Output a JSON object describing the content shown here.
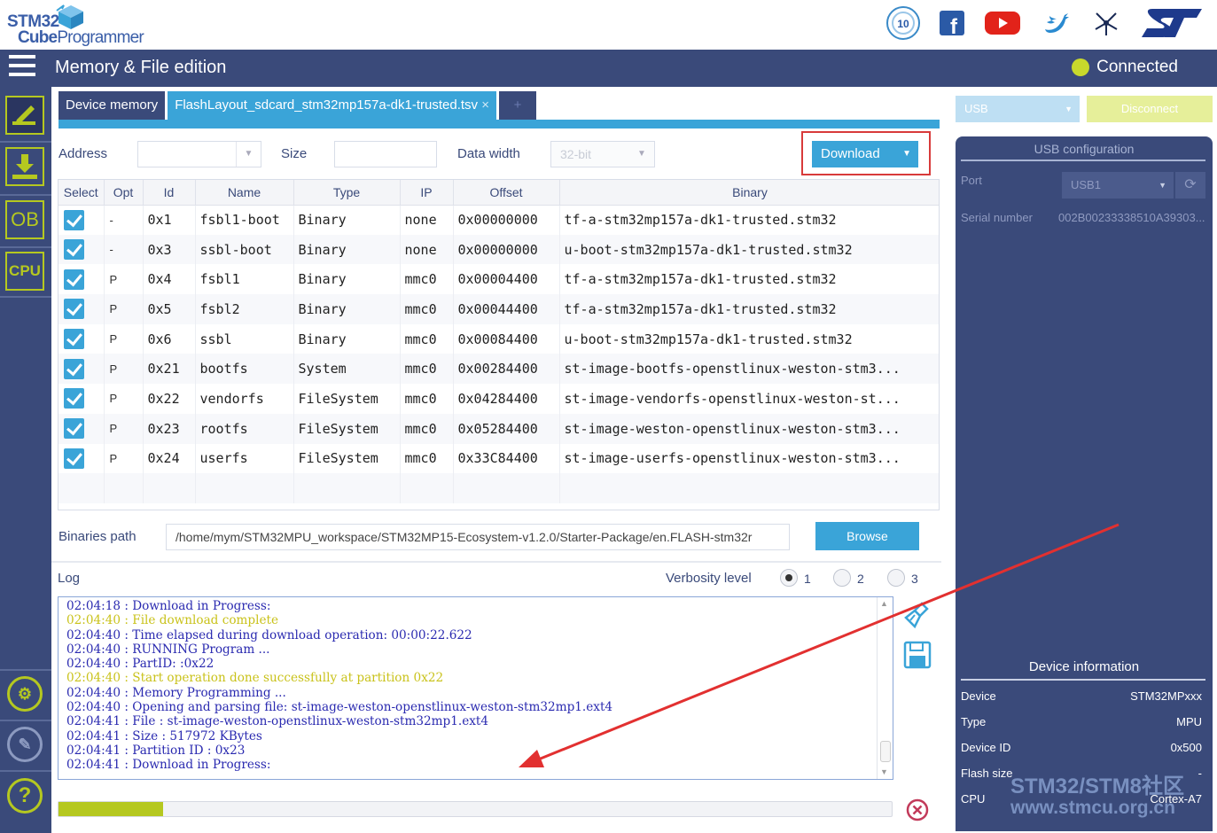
{
  "brand": {
    "line1": "STM32",
    "line2a": "Cube",
    "line2b": "Programmer"
  },
  "social_icons": [
    "anniversary-badge-icon",
    "facebook-icon",
    "youtube-icon",
    "twitter-icon",
    "network-icon",
    "st-logo-icon"
  ],
  "header": {
    "title": "Memory & File edition",
    "status": "Connected",
    "status_color": "#c8d92c"
  },
  "sidebar": {
    "items": [
      "edit-icon",
      "download-icon",
      "OB",
      "CPU"
    ],
    "bottom": [
      "swv-icon",
      "plugin-icon",
      "help-icon"
    ]
  },
  "tabs": [
    {
      "label": "Device memory"
    },
    {
      "label": "FlashLayout_sdcard_stm32mp157a-dk1-trusted.tsv",
      "close": "×"
    },
    {
      "label": "+"
    }
  ],
  "controls": {
    "address_label": "Address",
    "address_value": "",
    "size_label": "Size",
    "size_value": "",
    "data_width_label": "Data width",
    "data_width_value": "32-bit",
    "download_label": "Download"
  },
  "table": {
    "headers": [
      "Select",
      "Opt",
      "Id",
      "Name",
      "Type",
      "IP",
      "Offset",
      "Binary"
    ],
    "rows": [
      {
        "checked": true,
        "opt": "-",
        "id": "0x1",
        "name": "fsbl1-boot",
        "type": "Binary",
        "ip": "none",
        "offset": "0x00000000",
        "binary": "tf-a-stm32mp157a-dk1-trusted.stm32"
      },
      {
        "checked": true,
        "opt": "-",
        "id": "0x3",
        "name": "ssbl-boot",
        "type": "Binary",
        "ip": "none",
        "offset": "0x00000000",
        "binary": "u-boot-stm32mp157a-dk1-trusted.stm32"
      },
      {
        "checked": true,
        "opt": "P",
        "id": "0x4",
        "name": "fsbl1",
        "type": "Binary",
        "ip": "mmc0",
        "offset": "0x00004400",
        "binary": "tf-a-stm32mp157a-dk1-trusted.stm32"
      },
      {
        "checked": true,
        "opt": "P",
        "id": "0x5",
        "name": "fsbl2",
        "type": "Binary",
        "ip": "mmc0",
        "offset": "0x00044400",
        "binary": "tf-a-stm32mp157a-dk1-trusted.stm32"
      },
      {
        "checked": true,
        "opt": "P",
        "id": "0x6",
        "name": "ssbl",
        "type": "Binary",
        "ip": "mmc0",
        "offset": "0x00084400",
        "binary": "u-boot-stm32mp157a-dk1-trusted.stm32"
      },
      {
        "checked": true,
        "opt": "P",
        "id": "0x21",
        "name": "bootfs",
        "type": "System",
        "ip": "mmc0",
        "offset": "0x00284400",
        "binary": "st-image-bootfs-openstlinux-weston-stm3..."
      },
      {
        "checked": true,
        "opt": "P",
        "id": "0x22",
        "name": "vendorfs",
        "type": "FileSystem",
        "ip": "mmc0",
        "offset": "0x04284400",
        "binary": "st-image-vendorfs-openstlinux-weston-st..."
      },
      {
        "checked": true,
        "opt": "P",
        "id": "0x23",
        "name": "rootfs",
        "type": "FileSystem",
        "ip": "mmc0",
        "offset": "0x05284400",
        "binary": "st-image-weston-openstlinux-weston-stm3..."
      },
      {
        "checked": true,
        "opt": "P",
        "id": "0x24",
        "name": "userfs",
        "type": "FileSystem",
        "ip": "mmc0",
        "offset": "0x33C84400",
        "binary": "st-image-userfs-openstlinux-weston-stm3..."
      }
    ]
  },
  "binaries": {
    "label": "Binaries path",
    "path": "/home/mym/STM32MPU_workspace/STM32MP15-Ecosystem-v1.2.0/Starter-Package/en.FLASH-stm32r",
    "browse_label": "Browse"
  },
  "log": {
    "label": "Log",
    "verbosity_label": "Verbosity level",
    "levels": [
      "1",
      "2",
      "3"
    ],
    "selected_level": "1",
    "lines": [
      {
        "text": "02:04:18 : Download in Progress:",
        "color": "blue"
      },
      {
        "text": "02:04:40 : File download complete",
        "color": "yellow"
      },
      {
        "text": "02:04:40 : Time elapsed during download operation: 00:00:22.622",
        "color": "blue"
      },
      {
        "text": "02:04:40 : RUNNING Program ...",
        "color": "blue"
      },
      {
        "text": "02:04:40 : PartID: :0x22",
        "color": "blue"
      },
      {
        "text": "02:04:40 : Start operation done successfully at partition 0x22",
        "color": "yellow"
      },
      {
        "text": "02:04:40 : Memory Programming ...",
        "color": "blue"
      },
      {
        "text": "02:04:40 : Opening and parsing file: st-image-weston-openstlinux-weston-stm32mp1.ext4",
        "color": "blue"
      },
      {
        "text": "02:04:41 : File : st-image-weston-openstlinux-weston-stm32mp1.ext4",
        "color": "blue"
      },
      {
        "text": "02:04:41 : Size : 517972 KBytes",
        "color": "blue"
      },
      {
        "text": "02:04:41 : Partition ID : 0x23",
        "color": "blue"
      },
      {
        "text": "02:04:41 : Download in Progress:",
        "color": "blue"
      }
    ],
    "progress_fraction": 0.125
  },
  "connection": {
    "interface": "USB",
    "disconnect_label": "Disconnect",
    "config_title": "USB configuration",
    "port_label": "Port",
    "port_value": "USB1",
    "serial_label": "Serial number",
    "serial_value": "002B00233338510A39303..."
  },
  "device_info": {
    "title": "Device information",
    "rows": [
      {
        "key": "Device",
        "value": "STM32MPxxx"
      },
      {
        "key": "Type",
        "value": "MPU"
      },
      {
        "key": "Device ID",
        "value": "0x500"
      },
      {
        "key": "Flash size",
        "value": "-"
      },
      {
        "key": "CPU",
        "value": "Cortex-A7"
      }
    ]
  },
  "watermark": {
    "line1": "STM32/STM8社区",
    "line2": "www.stmcu.org.cn"
  },
  "colors": {
    "navy": "#3a4a7a",
    "accent_blue": "#3aa4d8",
    "lime": "#b5c820",
    "highlight_red": "#d83a3a"
  }
}
